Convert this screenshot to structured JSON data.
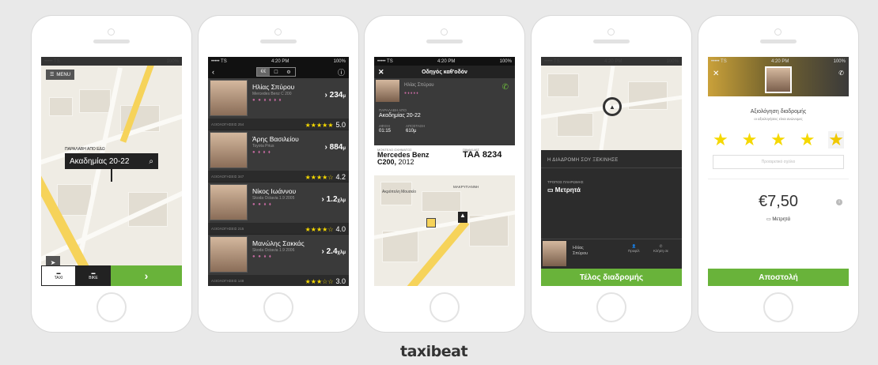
{
  "brand": {
    "logo": "taxibeat",
    "accent": "#69b33a",
    "star_color": "#f5d800"
  },
  "status_bar": {
    "carrier": "••••• TS",
    "time": "4:20 PM",
    "battery": "100%"
  },
  "screen1": {
    "menu_label": "MENU",
    "hint": "ΠΑΡΑΛΑΒΗ ΑΠΟ ΕΔΩ",
    "address": "Ακαδημίας 20-22",
    "tabs": [
      "TAXI",
      "BIKE"
    ],
    "go_label": "›"
  },
  "screen2": {
    "segments": [
      "€€",
      "☐",
      "⚙"
    ],
    "drivers": [
      {
        "name": "Ηλίας Σπύρου",
        "car": "Mercedes Benz C 200",
        "icons": "● ● ⬧ ⬧ ⬧ ⬧",
        "distance": "234",
        "unit": "μ",
        "row_label": "ΑΞΙΟΛΟΓΗΣΕΙΣ 254",
        "stars": "★★★★★",
        "rating": "5.0"
      },
      {
        "name": "Άρης Βασιλείου",
        "car": "Toyota Prius",
        "icons": "● ⬧ ⬧ ⬧",
        "distance": "884",
        "unit": "μ",
        "row_label": "ΑΞΙΟΛΟΓΗΣΕΙΣ 347",
        "stars": "★★★★☆",
        "rating": "4.2"
      },
      {
        "name": "Νίκος Ιωάννου",
        "car": "Skoda Octavia 1.9 2005",
        "icons": "● ● ⬧ ⬧",
        "distance": "1.2",
        "unit": "χλμ",
        "row_label": "ΑΞΙΟΛΟΓΗΣΕΙΣ 215",
        "stars": "★★★★☆",
        "rating": "4.0"
      },
      {
        "name": "Μανώλης Σακκάς",
        "car": "Skoda Octavia 1.9 2006",
        "icons": "● ● ⬧ ⬧",
        "distance": "2.4",
        "unit": "χλμ",
        "row_label": "ΑΞΙΟΛΟΓΗΣΕΙΣ 148",
        "stars": "★★★☆☆",
        "rating": "3.0"
      }
    ]
  },
  "screen3": {
    "title": "Οδηγός καθ'οδόν",
    "driver_name": "Ηλίας Σπύρου",
    "icons": "● ⬧ ⬧ ⬧ ⬧",
    "pickup_label": "ΠΑΡΑΛΑΒΗ ΑΠΟ",
    "pickup": "Ακαδημίας 20-22",
    "eta_label": "ΑΦΙΞΗ",
    "eta": "01:15",
    "distance_label": "ΑΠΟΣΤΑΣΗ",
    "distance": "610μ",
    "car_label": "ΜΟΝΤΕΛΟ ΟΧΗΜΑΤΟΣ",
    "car_model": "Mercedes Benz",
    "car_model2": "C200,",
    "car_year": " 2012",
    "plate_label": "ΠΙΝΑΚΙΔΕΣ",
    "plate": "ΤΑΑ 8234",
    "map_label1": "Ακρόπολη Μουσείο",
    "map_label2": "ΜΑΚΡΥΓΙΑΝΝΗ"
  },
  "screen4": {
    "section": "Η ΔΙΑΔΡΟΜΗ ΣΟΥ ΞΕΚΙΝΗΣΕ",
    "payment_label": "ΤΡΟΠΟΣ ΠΛΗΡΩΜΗΣ",
    "payment": "Μετρητά",
    "driver_first": "Ηλίας",
    "driver_last": "Σπύρου",
    "action1": "Προφίλ",
    "action2": "Κλήση σε",
    "button": "Τέλος διαδρομής"
  },
  "screen5": {
    "title": "Αξιολόγηση διαδρομής",
    "subtitle": "οι αξιολογήσεις είναι ανώνυμες",
    "stars": [
      "★",
      "★",
      "★",
      "★",
      "★"
    ],
    "comment_placeholder": "Προαιρετικό σχόλιο",
    "price": "€7,50",
    "payment": "Μετρητά",
    "button": "Αποστολή"
  }
}
